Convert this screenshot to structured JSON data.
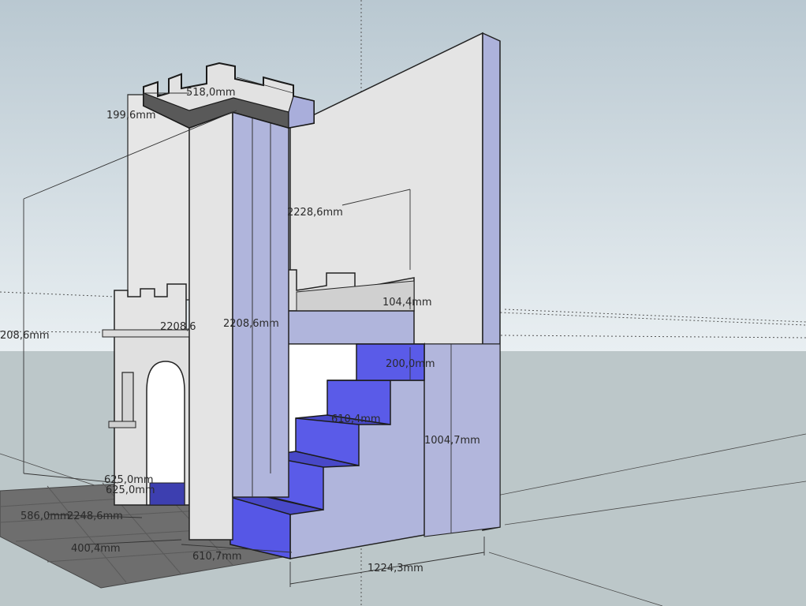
{
  "viewport": {
    "scene": "sketchup-3d-model",
    "sky_color": "#c5d2d9",
    "ground_color": "#bcc6c8",
    "wall_fill": "#b0b5dc",
    "wall_light": "#e2e2e2",
    "step_blue": "#5a5ce6",
    "floor_tile": "#6d6d6d"
  },
  "dimensions": {
    "tower_width": "518,0mm",
    "merlon_height": "199,6mm",
    "left_height": "208,6mm",
    "front_height_a": "2208,6",
    "front_height_b": "2208,6mm",
    "wall_depth": "2228,6mm",
    "parapet_thickness": "104,4mm",
    "step_riser": "200,0mm",
    "stair_run": "610,4mm",
    "platform_height": "1004,7mm",
    "door_width_a": "625,0mm",
    "door_width_b": "625,0mm",
    "floor_depth": "586,0mm",
    "floor_width": "2248,6mm",
    "floor_small": "400,4mm",
    "stair_depth": "610,7mm",
    "stair_width": "1224,3mm"
  }
}
